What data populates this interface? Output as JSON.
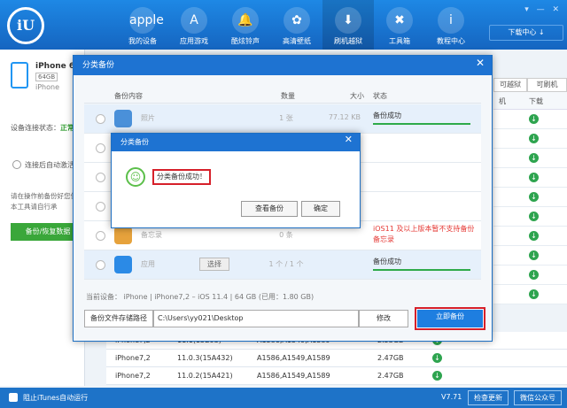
{
  "nav": {
    "logo": "iU",
    "items": [
      {
        "label": "我的设备",
        "icon": "apple"
      },
      {
        "label": "应用游戏",
        "icon": "A"
      },
      {
        "label": "酷炫铃声",
        "icon": "🔔"
      },
      {
        "label": "高清壁纸",
        "icon": "✿"
      },
      {
        "label": "刷机越狱",
        "icon": "⬇"
      },
      {
        "label": "工具箱",
        "icon": "✖"
      },
      {
        "label": "教程中心",
        "icon": "i"
      }
    ],
    "window_controls": "▾ — ✕",
    "download_center": "下载中心 ↓"
  },
  "left": {
    "device_name": "iPhone 6",
    "storage": "64GB",
    "model": "iPhone",
    "connection_label": "设备连接状态：",
    "connection_value": "正常",
    "auto_label": "连接后自动激活",
    "tip": "请在操作前备份好您使用本工具请自行承",
    "backup_button": "备份/恢复数据"
  },
  "right": {
    "tab1": "可越狱",
    "tab2": "可刷机",
    "col1": "机",
    "col2": "下载"
  },
  "firmware_rows": [
    {
      "model": "iPhone7,2",
      "version": "11.1(15B93)",
      "ids": "A1586,A1549,A1589",
      "size": "2.53GB"
    },
    {
      "model": "iPhone7,2",
      "version": "11.0.3(15A432)",
      "ids": "A1586,A1549,A1589",
      "size": "2.47GB"
    },
    {
      "model": "iPhone7,2",
      "version": "11.0.2(15A421)",
      "ids": "A1586,A1549,A1589",
      "size": "2.47GB"
    }
  ],
  "bottom": {
    "itunes": "阻止iTunes自动运行",
    "version": "V7.71",
    "check_update": "检查更新",
    "wechat": "微信公众号"
  },
  "dialog": {
    "title": "分类备份",
    "cols": {
      "content": "备份内容",
      "count": "数量",
      "size": "大小",
      "status": "状态"
    },
    "rows": [
      {
        "name": "照片",
        "count": "1 张",
        "size": "77.12 KB",
        "status": "备份成功",
        "icon_color": "#4a90d9"
      },
      {
        "name": "",
        "count": "",
        "size": "",
        "status": "",
        "icon_color": "#cccccc"
      },
      {
        "name": "",
        "count": "",
        "size": "",
        "status": "",
        "icon_color": "#cccccc"
      },
      {
        "name": "",
        "count": "",
        "size": "",
        "status": "",
        "icon_color": "#cccccc"
      },
      {
        "name": "备忘录",
        "count": "0 条",
        "size": "",
        "status": "iOS11 及以上版本暂不支持备份备忘录",
        "icon_color": "#e6a23c"
      },
      {
        "name": "应用",
        "count": "1 个 / 1 个",
        "size": "",
        "status": "备份成功",
        "select": "选择",
        "icon_color": "#2b8ae6"
      }
    ],
    "device_info": "当前设备：  iPhone    |    iPhone7,2 – iOS 11.4    |    64 GB    (已用：1.80 GB)",
    "path_label": "备份文件存储路径",
    "path_value": "C:\\Users\\yy021\\Desktop",
    "modify": "修改",
    "start": "立即备份"
  },
  "popup": {
    "title": "分类备份",
    "message": "分类备份成功！",
    "view": "查看备份",
    "ok": "确定"
  }
}
